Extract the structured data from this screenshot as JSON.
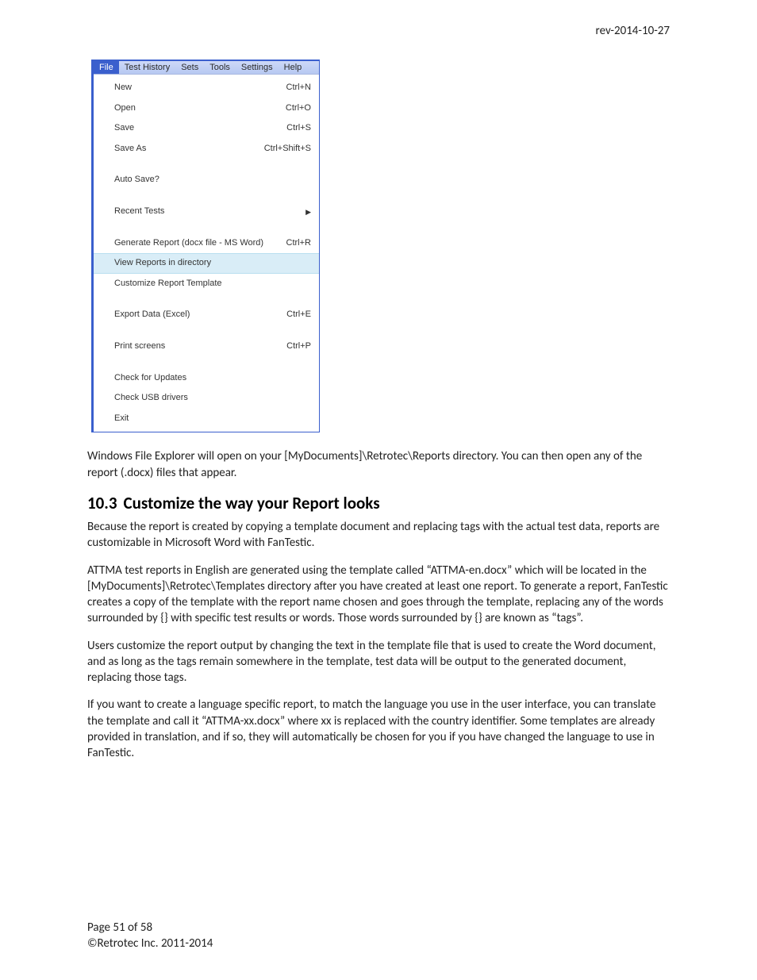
{
  "header": {
    "revision": "rev-2014-10-27"
  },
  "menubar": [
    "File",
    "Test History",
    "Sets",
    "Tools",
    "Settings",
    "Help"
  ],
  "menubar_active_index": 0,
  "menu": {
    "items": [
      {
        "label": "New",
        "shortcut": "Ctrl+N"
      },
      {
        "label": "Open",
        "shortcut": "Ctrl+O"
      },
      {
        "label": "Save",
        "shortcut": "Ctrl+S"
      },
      {
        "label": "Save As",
        "shortcut": "Ctrl+Shift+S"
      },
      {
        "gap": true
      },
      {
        "label": "Auto Save?"
      },
      {
        "gap": true
      },
      {
        "label": "Recent Tests",
        "submenu": true
      },
      {
        "gap": true
      },
      {
        "label": "Generate Report (docx file - MS Word)",
        "shortcut": "Ctrl+R"
      },
      {
        "label": "View Reports in directory",
        "highlighted": true
      },
      {
        "label": "Customize Report Template"
      },
      {
        "gap": true
      },
      {
        "label": "Export Data (Excel)",
        "shortcut": "Ctrl+E"
      },
      {
        "gap": true
      },
      {
        "label": "Print screens",
        "shortcut": "Ctrl+P"
      },
      {
        "gap": true
      },
      {
        "label": "Check for Updates"
      },
      {
        "label": "Check USB drivers"
      },
      {
        "label": "Exit"
      }
    ]
  },
  "paragraphs": {
    "p1": "Windows File Explorer will open on your [MyDocuments]\\Retrotec\\Reports directory.  You can then open any of the report (.docx) files that appear.",
    "heading_num": "10.3",
    "heading_text": "Customize the way your Report looks",
    "p2": "Because the report is created by copying a template document and replacing tags with the actual test data, reports are customizable in Microsoft Word with FanTestic.",
    "p3": "ATTMA test reports in English are generated using the template called “ATTMA-en.docx” which will be located in the [MyDocuments]\\Retrotec\\Templates directory after you have created at least one report. To generate a report, FanTestic creates a copy of the template with the report name chosen and goes through the template, replacing any of the words surrounded by {}  with specific test results or words. Those words surrounded by {} are known as “tags”.",
    "p4": "Users customize the report output by changing the text in the template file that is used to create the Word document, and as long as the tags remain somewhere in the template, test data will be output to the generated document, replacing those tags.",
    "p5": "If you want to create a language specific report, to match the language you use in the user interface, you can translate the template and call it “ATTMA-xx.docx” where xx is replaced with the country identifier. Some templates are already provided in translation, and if so, they will automatically be chosen for you if you have changed the language to use in FanTestic."
  },
  "footer": {
    "page": "Page 51 of 58",
    "copyright": "©Retrotec Inc. 2011-2014"
  }
}
